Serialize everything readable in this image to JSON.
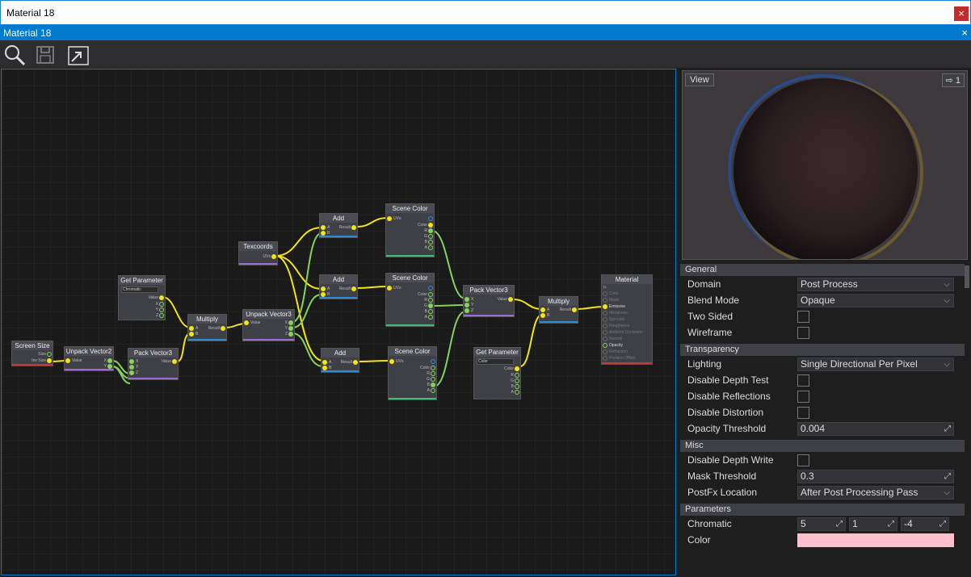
{
  "window": {
    "title": "Material 18",
    "close": "×"
  },
  "tab": {
    "title": "Material 18",
    "close": "×"
  },
  "toolbar": {
    "icons": [
      "search-icon",
      "save-icon",
      "open-window-icon"
    ]
  },
  "nodes": {
    "screen_size": {
      "title": "Screen Size",
      "pins": [
        "Size",
        "Inv Size"
      ]
    },
    "unpack_vec2": {
      "title": "Unpack Vector2",
      "pins": [
        "Value",
        "X",
        "Y"
      ]
    },
    "pack_vec3_a": {
      "title": "Pack Vector3",
      "pins": [
        "X",
        "Y",
        "Z",
        "Value"
      ]
    },
    "get_param_a": {
      "title": "Get Parameter",
      "field": "Chromatic",
      "pins": [
        "Value",
        "X",
        "Y",
        "Z"
      ]
    },
    "multiply_a": {
      "title": "Multiply",
      "pins": [
        "A",
        "B",
        "Result"
      ]
    },
    "unpack_vec3": {
      "title": "Unpack Vector3",
      "pins": [
        "Value",
        "X",
        "Y",
        "Z"
      ]
    },
    "texcoords": {
      "title": "Texcoords",
      "pins": [
        "UVs"
      ]
    },
    "add_a": {
      "title": "Add",
      "pins": [
        "A",
        "B",
        "Result"
      ]
    },
    "add_b": {
      "title": "Add",
      "pins": [
        "A",
        "B",
        "Result"
      ]
    },
    "add_c": {
      "title": "Add",
      "pins": [
        "A",
        "B",
        "Result"
      ]
    },
    "scene_a": {
      "title": "Scene Color",
      "pins": [
        "UVs",
        "Color",
        "R",
        "G",
        "B",
        "A"
      ]
    },
    "scene_b": {
      "title": "Scene Color",
      "pins": [
        "UVs",
        "Color",
        "R",
        "G",
        "B",
        "A"
      ]
    },
    "scene_c": {
      "title": "Scene Color",
      "pins": [
        "UVs",
        "Color",
        "R",
        "G",
        "B",
        "A"
      ]
    },
    "pack_vec3_b": {
      "title": "Pack Vector3",
      "pins": [
        "X",
        "Y",
        "Z",
        "Value"
      ]
    },
    "multiply_b": {
      "title": "Multiply",
      "pins": [
        "A",
        "B",
        "Result"
      ]
    },
    "get_param_b": {
      "title": "Get Parameter",
      "field": "Color",
      "pins": [
        "Color",
        "R",
        "G",
        "B",
        "A"
      ]
    },
    "material": {
      "title": "Material",
      "pins": [
        "Color",
        "Mask",
        "Emissive",
        "Metalness",
        "Specular",
        "Roughness",
        "Ambient Occlusion",
        "Normal",
        "Opacity",
        "Refraction",
        "Position Offset"
      ]
    }
  },
  "viewport": {
    "view_label": "View",
    "count": "1"
  },
  "sections": {
    "general": "General",
    "transparency": "Transparency",
    "misc": "Misc",
    "parameters": "Parameters"
  },
  "props": {
    "domain": {
      "label": "Domain",
      "value": "Post Process"
    },
    "blend_mode": {
      "label": "Blend Mode",
      "value": "Opaque"
    },
    "two_sided": {
      "label": "Two Sided"
    },
    "wireframe": {
      "label": "Wireframe"
    },
    "lighting": {
      "label": "Lighting",
      "value": "Single Directional Per Pixel"
    },
    "disable_depth_test": {
      "label": "Disable Depth Test"
    },
    "disable_reflections": {
      "label": "Disable Reflections"
    },
    "disable_distortion": {
      "label": "Disable Distortion"
    },
    "opacity_threshold": {
      "label": "Opacity Threshold",
      "value": "0.004"
    },
    "disable_depth_write": {
      "label": "Disable Depth Write"
    },
    "mask_threshold": {
      "label": "Mask Threshold",
      "value": "0.3"
    },
    "postfx_location": {
      "label": "PostFx Location",
      "value": "After Post Processing Pass"
    },
    "chromatic": {
      "label": "Chromatic",
      "x": "5",
      "y": "1",
      "z": "-4"
    },
    "color": {
      "label": "Color",
      "value": "#ffc0cb"
    }
  },
  "colors": {
    "accent": "#007acc",
    "pin_yellow": "#f5e414",
    "pin_green": "#86d35b",
    "wire_green": "#86d35b"
  }
}
